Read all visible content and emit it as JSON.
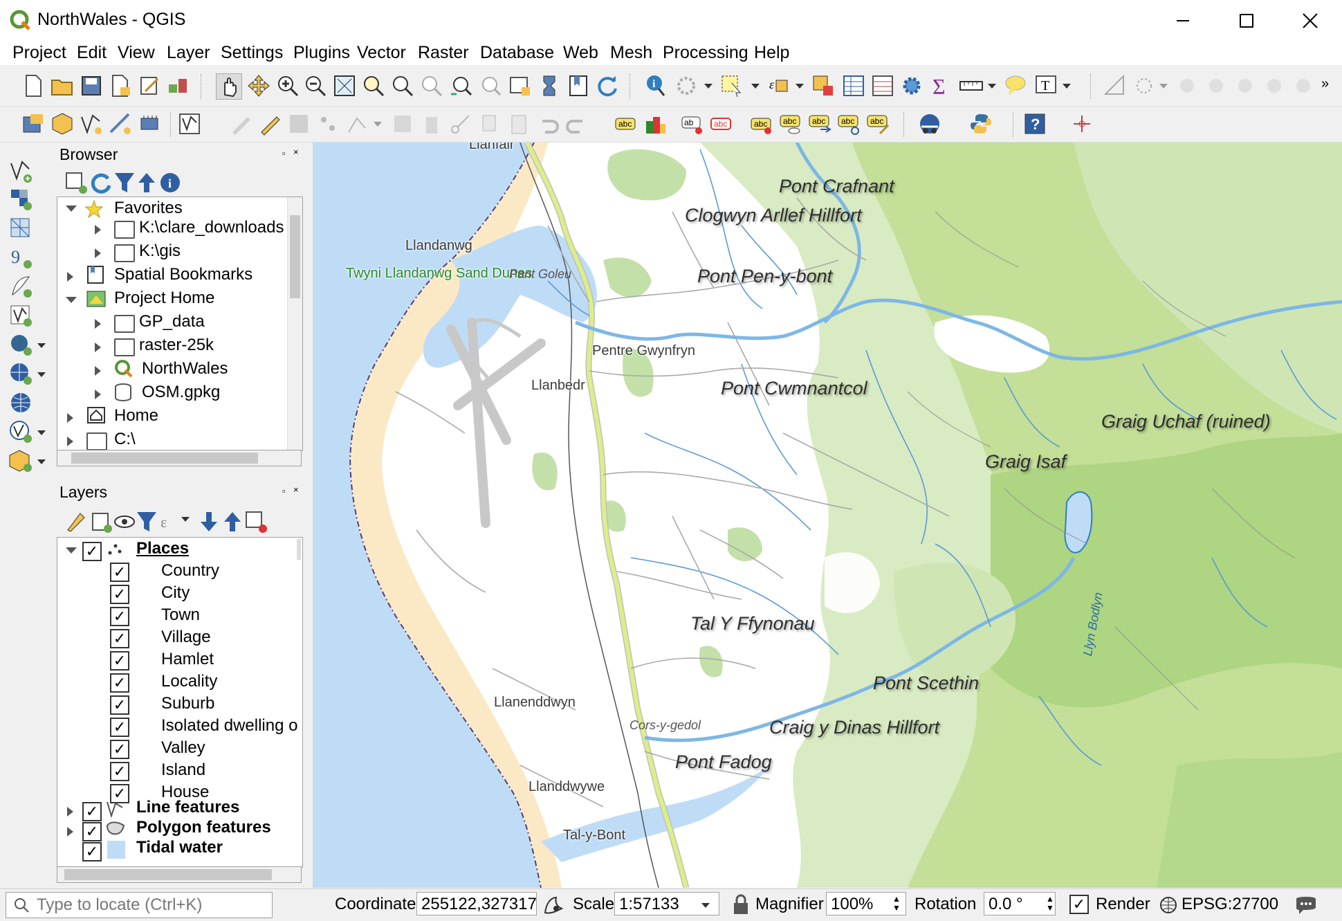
{
  "window": {
    "title": "NorthWales - QGIS",
    "accent": "#589632"
  },
  "menu": [
    "Project",
    "Edit",
    "View",
    "Layer",
    "Settings",
    "Plugins",
    "Vector",
    "Raster",
    "Database",
    "Web",
    "Mesh",
    "Processing",
    "Help"
  ],
  "browser": {
    "title": "Browser",
    "items": [
      {
        "label": "Favorites",
        "icon": "star-icon"
      },
      {
        "label": "K:\\clare_downloads",
        "icon": "folder-icon"
      },
      {
        "label": "K:\\gis",
        "icon": "folder-icon"
      },
      {
        "label": "Spatial Bookmarks",
        "icon": "bookmark-icon"
      },
      {
        "label": "Project Home",
        "icon": "project-home-icon"
      },
      {
        "label": "GP_data",
        "icon": "folder-icon"
      },
      {
        "label": "raster-25k",
        "icon": "folder-icon"
      },
      {
        "label": "NorthWales",
        "icon": "qgis-icon"
      },
      {
        "label": "OSM.gpkg",
        "icon": "geopackage-icon"
      },
      {
        "label": "Home",
        "icon": "home-icon"
      },
      {
        "label": "C:\\",
        "icon": "folder-icon"
      }
    ]
  },
  "layers": {
    "title": "Layers",
    "group": "Places",
    "sublayers": [
      "Country",
      "City",
      "Town",
      "Village",
      "Hamlet",
      "Locality",
      "Suburb",
      "Isolated dwelling o",
      "Valley",
      "Island",
      "House"
    ],
    "others": [
      {
        "label": "Line features",
        "icon": "line-layer-icon"
      },
      {
        "label": "Polygon features",
        "icon": "polygon-layer-icon"
      },
      {
        "label": "Tidal water",
        "icon": "fill-swatch-icon"
      }
    ],
    "check": "✓"
  },
  "map_labels": {
    "llanfair": "Llanfair",
    "pont_crafnant": "Pont Crafnant",
    "clogwyn": "Clogwyn Arllef Hillfort",
    "llandanwg": "Llandanwg",
    "twyni": "Twyni Llandanwg Sand Dunes",
    "pant_goleu": "Pant Goleu",
    "pont_pen": "Pont Pen-y-bont",
    "pentre": "Pentre Gwynfryn",
    "llanbedr": "Llanbedr",
    "pont_cwm": "Pont Cwmnantcol",
    "graig_uchaf": "Graig Uchaf (ruined)",
    "graig_isaf": "Graig Isaf",
    "tal_y_ff": "Tal Y Ffynonau",
    "llyn": "Llyn Bodlyn",
    "pont_scethin": "Pont Scethin",
    "llanenddwyn": "Llanenddwyn",
    "cors": "Cors-y-gedol",
    "craig_dinas": "Craig y Dinas Hillfort",
    "pont_fadog": "Pont Fadog",
    "llanddwywe": "Llanddwywe",
    "tal_y_bont": "Tal-y-Bont"
  },
  "status": {
    "locate_placeholder": "Type to locate (Ctrl+K)",
    "coordinate_label": "Coordinate",
    "coordinate": "255122,327317",
    "scale_label": "Scale",
    "scale": "1:57133",
    "magnifier_label": "Magnifier",
    "magnifier": "100%",
    "rotation_label": "Rotation",
    "rotation": "0.0 °",
    "render_label": "Render",
    "crs": "EPSG:27700"
  }
}
